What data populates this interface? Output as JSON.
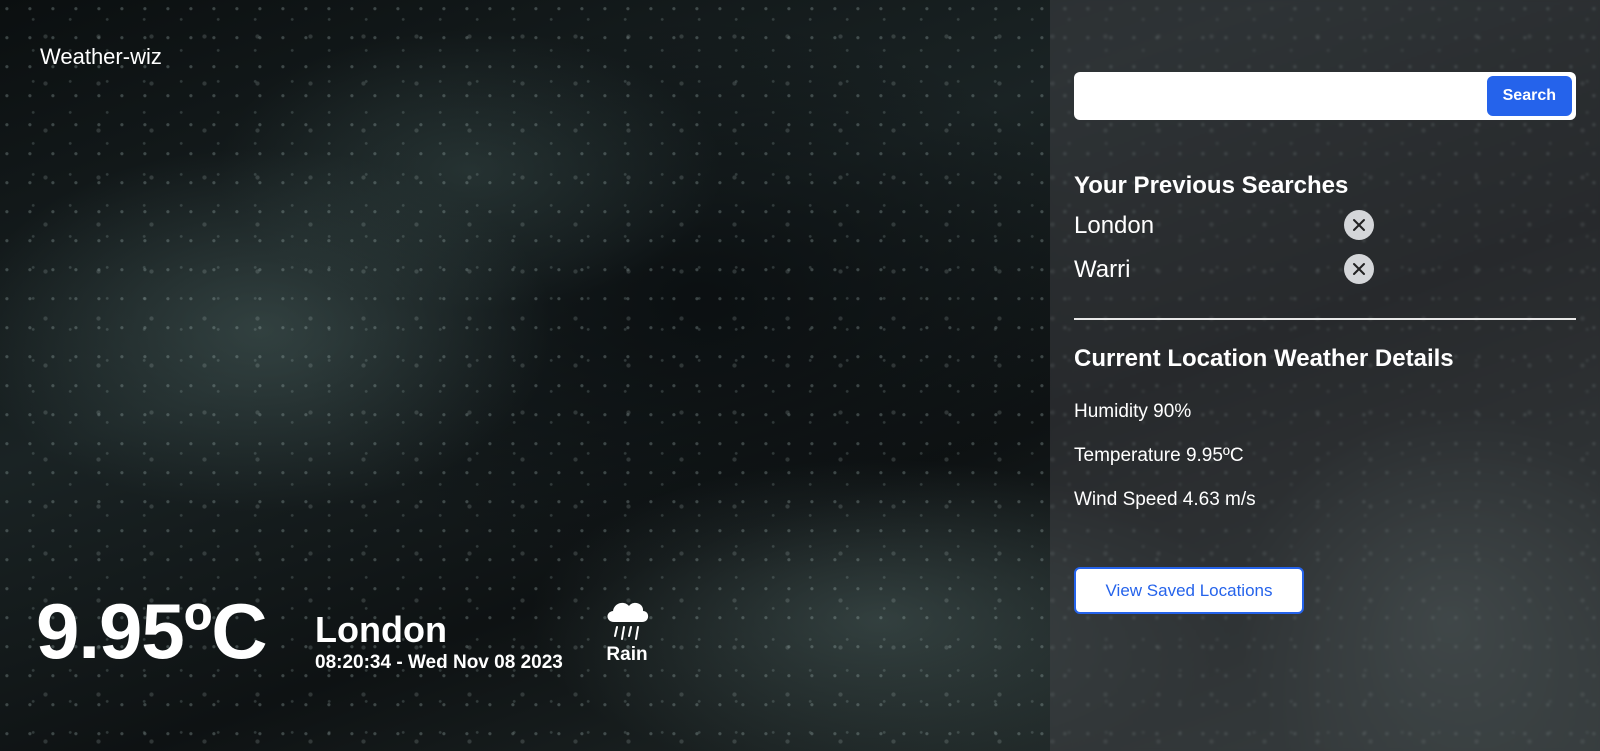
{
  "app": {
    "title": "Weather-wiz"
  },
  "current": {
    "temperature": "9.95ºC",
    "city": "London",
    "datetime": "08:20:34 - Wed Nov 08 2023",
    "condition": "Rain",
    "condition_icon": "rain-cloud-icon"
  },
  "search": {
    "value": "",
    "placeholder": "",
    "button_label": "Search"
  },
  "previous_searches": {
    "heading": "Your Previous Searches",
    "items": [
      {
        "label": "London",
        "remove_icon": "close-icon"
      },
      {
        "label": "Warri",
        "remove_icon": "close-icon"
      }
    ]
  },
  "details": {
    "heading": "Current Location Weather Details",
    "humidity": "Humidity 90%",
    "temperature": "Temperature 9.95ºC",
    "wind_speed": "Wind Speed 4.63 m/s"
  },
  "saved": {
    "button_label": "View Saved Locations"
  },
  "colors": {
    "accent": "#2563eb",
    "panel": "#46484c",
    "text": "#ffffff"
  }
}
